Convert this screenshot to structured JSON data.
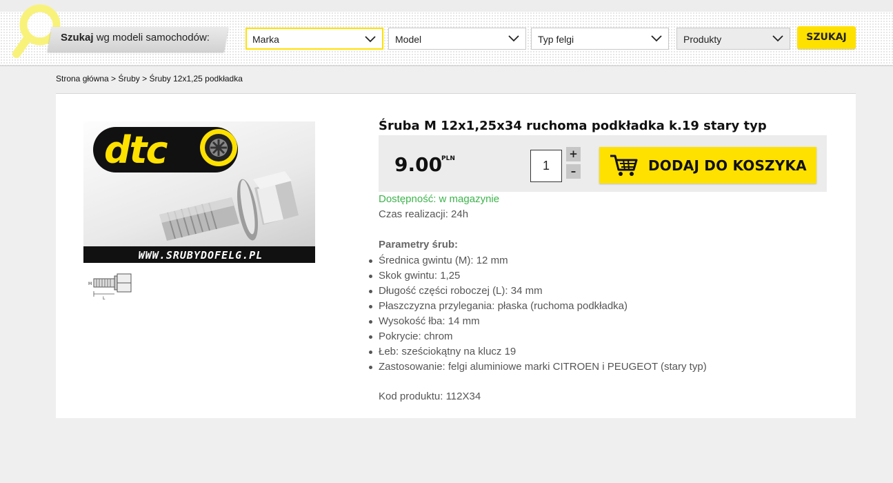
{
  "header": {
    "search_label_bold": "Szukaj",
    "search_label_rest": " wg modeli samochodów:",
    "selects": [
      {
        "label": "Marka"
      },
      {
        "label": "Model"
      },
      {
        "label": "Typ felgi"
      },
      {
        "label": "Produkty"
      }
    ],
    "search_button": "SZUKAJ"
  },
  "breadcrumb": {
    "items": [
      "Strona główna",
      "Śruby",
      "Śruby 12x1,25 podkładka"
    ],
    "separator": " > "
  },
  "product": {
    "title": "Śruba M 12x1,25x34 ruchoma podkładka k.19 stary typ",
    "price": "9.00",
    "currency": "PLN",
    "quantity": "1",
    "qty_plus": "+",
    "qty_minus": "–",
    "add_to_cart": "DODAJ DO KOSZYKA",
    "availability": "Dostępność: w magazynie",
    "realization": "Czas realizacji: 24h",
    "params_title": "Parametry śrub:",
    "params": [
      "Średnica gwintu (M): 12 mm",
      "Skok gwintu: 1,25",
      "Długość części roboczej (L): 34 mm",
      "Płaszczyzna przylegania: płaska (ruchoma podkładka)",
      "Wysokość łba: 14 mm",
      "Pokrycie: chrom",
      "Łeb: sześciokątny na klucz 19",
      "Zastosowanie: felgi aluminiowe marki CITROEN i PEUGEOT (stary typ)"
    ],
    "code": "Kod produktu: 112X34",
    "image_logo": "dtc",
    "image_url_text": "WWW.SRUBYDOFELG.PL",
    "thumb_labels": [
      "M",
      "L"
    ]
  },
  "colors": {
    "accent": "#ffe100",
    "available": "#3cb44b"
  },
  "icons": {
    "search": "magnifier-icon",
    "dropdown": "chevron-down-icon",
    "cart": "shopping-cart-icon"
  }
}
